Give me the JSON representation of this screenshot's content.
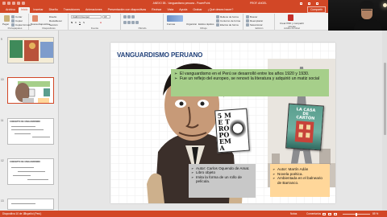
{
  "window": {
    "title": "ANEXO 3B - Vanguardismo peruano - PowerPoint",
    "user": "PROF. ANGEL",
    "camera_label": "PROF. ANGEL"
  },
  "tabs": [
    {
      "label": "Archivo"
    },
    {
      "label": "Inicio"
    },
    {
      "label": "Insertar"
    },
    {
      "label": "Diseño"
    },
    {
      "label": "Transiciones"
    },
    {
      "label": "Animaciones"
    },
    {
      "label": "Presentación con diapositivas"
    },
    {
      "label": "Revisar"
    },
    {
      "label": "Vista"
    },
    {
      "label": "Ayuda"
    },
    {
      "label": "Grabar"
    },
    {
      "label": "¿Qué desea hacer?"
    }
  ],
  "share_label": "Compartir",
  "ribbon": {
    "groups": {
      "clipboard": "Portapapeles",
      "slides": "Diapositivas",
      "font": "Fuente",
      "paragraph": "Párrafo",
      "drawing": "Dibujo",
      "editing": "Edición",
      "adobe": "Adobe Acrobat"
    },
    "buttons": {
      "paste": "Pegar",
      "cut": "Cortar",
      "copy": "Copiar",
      "format_painter": "Copiar formato",
      "new_slide": "Nueva diapositiva",
      "layout": "Diseño",
      "reset": "Restablecer",
      "section": "Sección",
      "shapes": "Formas",
      "arrange": "Organizar",
      "quick_styles": "Estilos rápidos",
      "shape_fill": "Relleno de forma",
      "shape_outline": "Contorno de forma",
      "shape_effects": "Efectos de forma",
      "find": "Buscar",
      "replace": "Reemplazar",
      "select": "Seleccionar",
      "adobe_pdf": "Crear PDF y compartir vínculo"
    },
    "font_name": "Calibri (Cuerpo)",
    "font_size": "18"
  },
  "thumbnails": [
    {
      "num": "9",
      "title": ""
    },
    {
      "num": "10",
      "title": ""
    },
    {
      "num": "11",
      "title": "CONCEPTO DE VANGUARDISMO"
    },
    {
      "num": "12",
      "title": "CONCEPTO DE VANGUARDISMO"
    },
    {
      "num": "13",
      "title": ""
    }
  ],
  "slide": {
    "title": "VANGUARDISMO PERUANO",
    "intro_bullets": [
      "El vanguardismo en el Perú se desarrolló entre los años 1920 y 1930.",
      "Fue un reflejo del europeo, se renovó la literatura y adquirió un matiz social"
    ],
    "book1_cover": "5 ME TRO POEMA",
    "book2_cover": "LA CASA DE CARTÓN",
    "left_box": [
      "Autor: Carlos Oquendo de Amat.",
      "Libro objeto",
      "Imita la forma de un rollo de película."
    ],
    "right_box": [
      "Autor: Martín Adán",
      "Novela poética.",
      "Ambientada en el balneario de Barranco."
    ]
  },
  "status": {
    "slide_info": "Diapositiva 10 de 13",
    "language": "Español (Perú)",
    "notes": "Notas",
    "comments": "Comentarios",
    "zoom": "85 %"
  }
}
